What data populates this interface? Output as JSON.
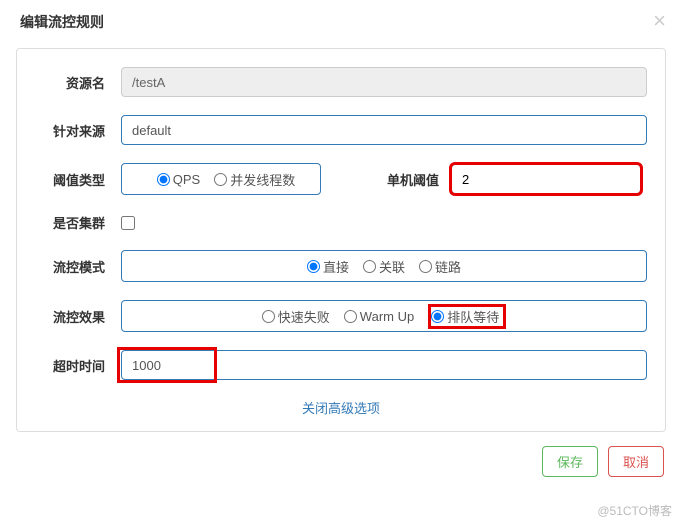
{
  "title": "编辑流控规则",
  "labels": {
    "resource": "资源名",
    "source": "针对来源",
    "thresholdType": "阈值类型",
    "singleThreshold": "单机阈值",
    "cluster": "是否集群",
    "mode": "流控模式",
    "effect": "流控效果",
    "timeout": "超时时间"
  },
  "values": {
    "resource": "/testA",
    "source": "default",
    "threshold": "2",
    "timeout": "1000"
  },
  "thresholdType": {
    "opts": [
      "QPS",
      "并发线程数"
    ],
    "selected": 0
  },
  "cluster": false,
  "mode": {
    "opts": [
      "直接",
      "关联",
      "链路"
    ],
    "selected": 0
  },
  "effect": {
    "opts": [
      "快速失败",
      "Warm Up",
      "排队等待"
    ],
    "selected": 2
  },
  "advLink": "关闭高级选项",
  "buttons": {
    "save": "保存",
    "cancel": "取消"
  },
  "watermark": "@51CTO博客"
}
